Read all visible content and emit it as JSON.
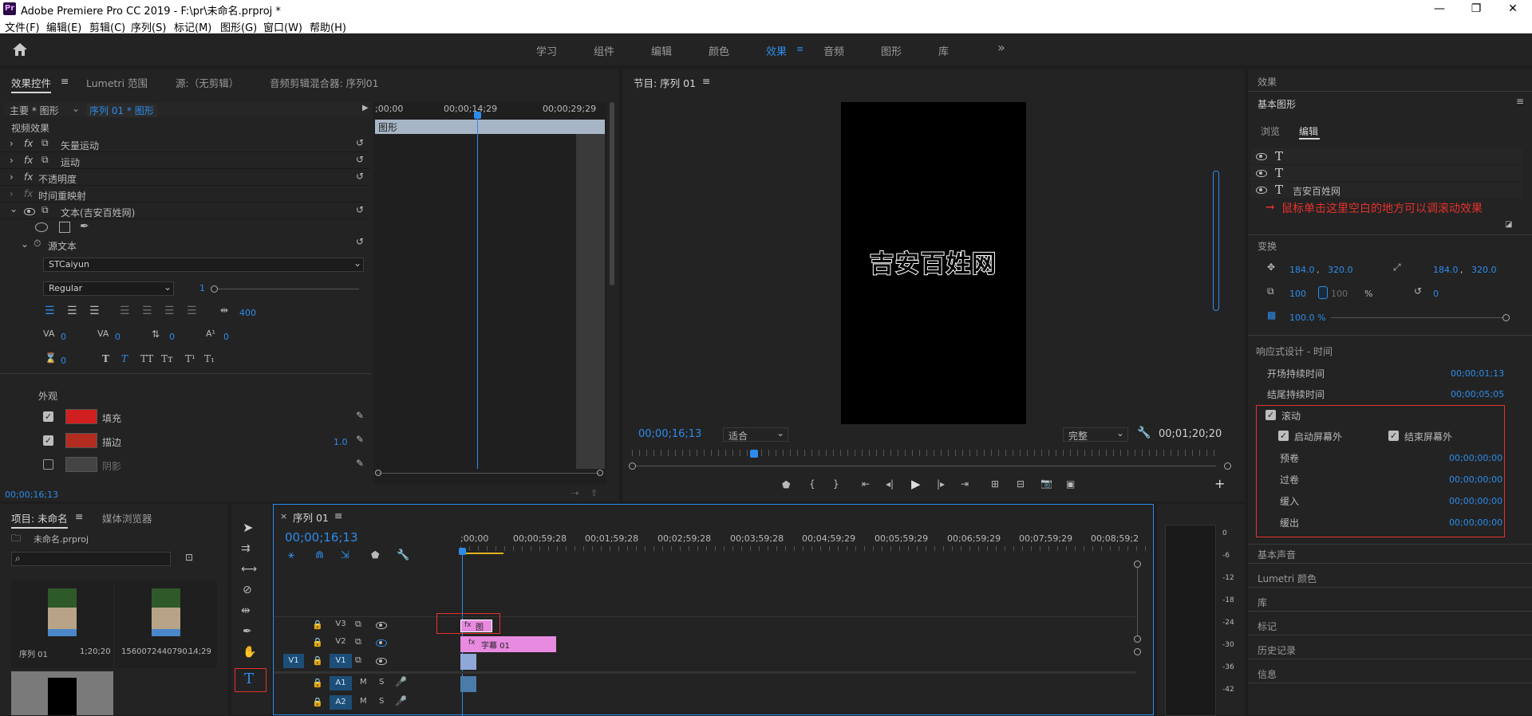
{
  "window": {
    "title": "Adobe Premiere Pro CC 2019 - F:\\pr\\未命名.prproj *",
    "app_icon": "Pr",
    "minimize": "—",
    "maximize": "❐",
    "close": "✕"
  },
  "menu": [
    "文件(F)",
    "编辑(E)",
    "剪辑(C)",
    "序列(S)",
    "标记(M)",
    "图形(G)",
    "窗口(W)",
    "帮助(H)"
  ],
  "workspaces": [
    "学习",
    "组件",
    "编辑",
    "颜色",
    "效果",
    "音频",
    "图形",
    "库"
  ],
  "workspace_active": "效果",
  "workspace_more": "»",
  "effect_controls": {
    "tabs": [
      "效果控件",
      "Lumetri 范围",
      "源:（无剪辑）",
      "音频剪辑混合器: 序列01"
    ],
    "master": "主要 * 图形",
    "sequence_clip": "序列 01 * 图形",
    "mini_timecodes": [
      ";00;00",
      "00;00;14;29",
      "00;00;29;29"
    ],
    "clip_label": "图形",
    "video_effects": "视频效果",
    "effects": [
      "矢量运动",
      "运动",
      "不透明度",
      "时间重映射",
      "文本(吉安百姓网)"
    ],
    "source_text": "源文本",
    "font": "STCaiyun",
    "font_style": "Regular",
    "font_size": "1",
    "tracking": "400",
    "kerning_vals": [
      "0",
      "0",
      "0",
      "0",
      "0"
    ],
    "style_glyphs": [
      "T",
      "T",
      "TT",
      "Tт",
      "T¹",
      "T₁"
    ],
    "appearance": "外观",
    "fill": "填充",
    "stroke": "描边",
    "shadow": "阴影",
    "stroke_width": "1.0",
    "fill_color": "#d11f1f",
    "stroke_color": "#b22d1f",
    "timecode": "00;00;16;13"
  },
  "program": {
    "title": "节目: 序列 01",
    "overlay_text": "吉安百姓网",
    "timecode": "00;00;16;13",
    "fit": "适合",
    "quality": "完整",
    "duration": "00;01;20;20"
  },
  "essential_graphics": {
    "section": "效果",
    "title": "基本图形",
    "tabs": [
      "浏览",
      "编辑"
    ],
    "layers": [
      "T",
      "T",
      "吉安百姓网"
    ],
    "annotation": "鼠标单击这里空白的地方可以调滚动效果",
    "transform": "变换",
    "pos_x": "184.0",
    "pos_y": "320.0",
    "anchor_x": "184.0",
    "anchor_y": "320.0",
    "scale": "100",
    "scale_h": "100",
    "scale_unit": "%",
    "rotation": "0",
    "opacity": "100.0 %",
    "responsive": "响应式设计 - 时间",
    "intro": "开场持续时间",
    "intro_val": "00;00;01;13",
    "outro": "结尾持续时间",
    "outro_val": "00;00;05;05",
    "roll": "滚动",
    "start_offscreen": "启动屏幕外",
    "end_offscreen": "结束屏幕外",
    "preroll": "预卷",
    "postroll": "过卷",
    "easein": "缓入",
    "easeout": "缓出",
    "roll_vals": [
      "00;00;00;00",
      "00;00;00;00",
      "00;00;00;00",
      "00;00;00;00"
    ],
    "other_panels": [
      "基本声音",
      "Lumetri 颜色",
      "库",
      "标记",
      "历史记录",
      "信息"
    ]
  },
  "project": {
    "tabs": [
      "项目: 未命名",
      "媒体浏览器"
    ],
    "file": "未命名.prproj",
    "items": [
      {
        "name": "序列 01",
        "dur": "1;20;20"
      },
      {
        "name": "1560072440790...",
        "dur": "14;29"
      }
    ]
  },
  "timeline": {
    "tab": "序列 01",
    "timecode": "00;00;16;13",
    "ruler": [
      ";00;00",
      "00;00;59;28",
      "00;01;59;28",
      "00;02;59;28",
      "00;03;59;28",
      "00;04;59;29",
      "00;05;59;29",
      "00;06;59;29",
      "00;07;59;29",
      "00;08;59;2"
    ],
    "tracks": [
      "V3",
      "V2",
      "V1",
      "A1",
      "A2"
    ],
    "src_v1": "V1",
    "clip_v3": "图",
    "clip_v2": "字幕 01",
    "m": "M",
    "s": "S"
  },
  "meter": [
    "0",
    "-6",
    "-12",
    "-18",
    "-24",
    "-30",
    "-36",
    "-42"
  ]
}
